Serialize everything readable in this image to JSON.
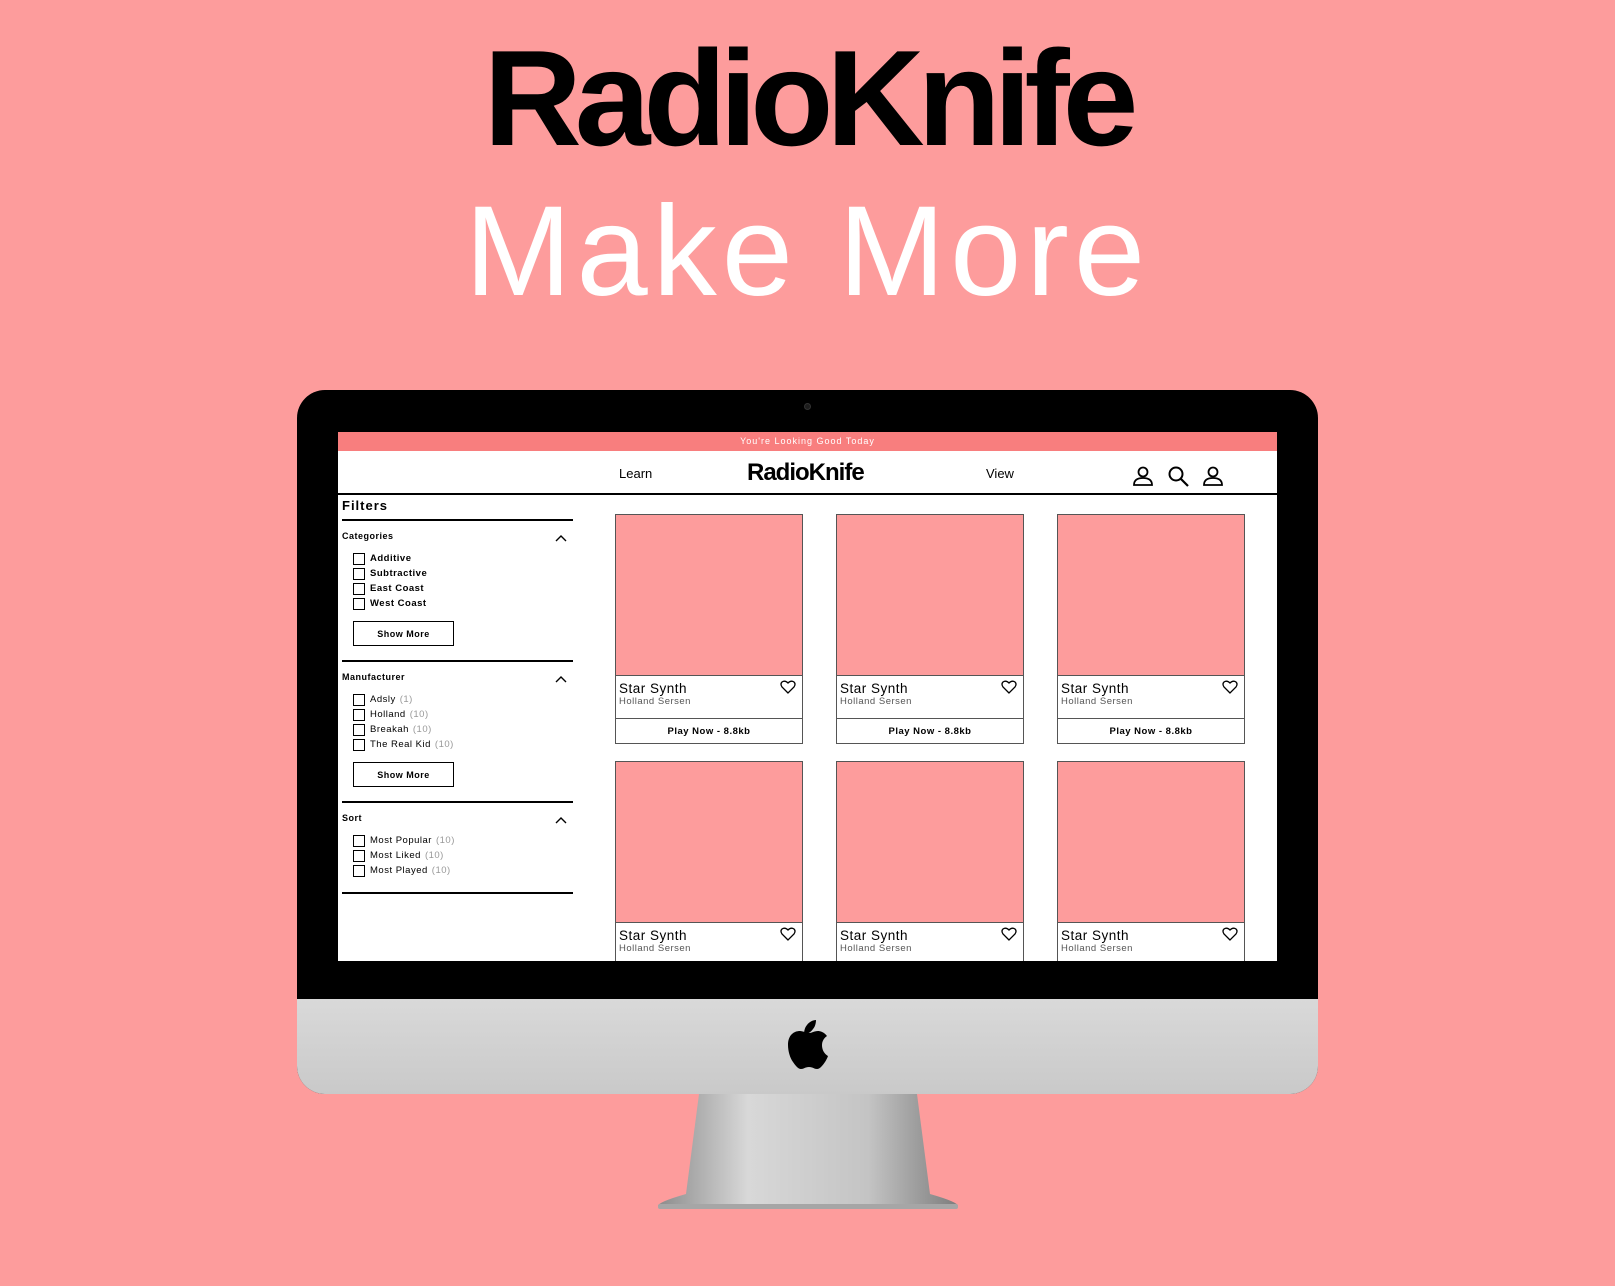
{
  "hero": {
    "title": "RadioKnife",
    "subtitle": "Make More"
  },
  "announcement": "You're Looking Good Today",
  "nav": {
    "links": [
      "Learn",
      "View"
    ],
    "logo": "RadioKnife",
    "icons": [
      "account-icon",
      "search-icon",
      "user-icon"
    ]
  },
  "sidebar": {
    "title": "Filters",
    "sections": [
      {
        "title": "Categories",
        "options": [
          {
            "label": "Additive",
            "count": ""
          },
          {
            "label": "Subtractive",
            "count": ""
          },
          {
            "label": "East Coast",
            "count": ""
          },
          {
            "label": "West Coast",
            "count": ""
          }
        ],
        "button": "Show More"
      },
      {
        "title": "Manufacturer",
        "options": [
          {
            "label": "Adsly",
            "count": "(1)"
          },
          {
            "label": "Holland",
            "count": "(10)"
          },
          {
            "label": "Breakah",
            "count": "(10)"
          },
          {
            "label": "The Real Kid",
            "count": "(10)"
          }
        ],
        "button": "Show More"
      },
      {
        "title": "Sort",
        "options": [
          {
            "label": "Most Popular",
            "count": "(10)"
          },
          {
            "label": "Most Liked",
            "count": "(10)"
          },
          {
            "label": "Most Played",
            "count": "(10)"
          }
        ],
        "button": ""
      }
    ]
  },
  "products": [
    {
      "name": "Star Synth",
      "maker": "Holland Sersen",
      "action": "Play Now - 8.8kb"
    },
    {
      "name": "Star Synth",
      "maker": "Holland Sersen",
      "action": "Play Now - 8.8kb"
    },
    {
      "name": "Star Synth",
      "maker": "Holland Sersen",
      "action": "Play Now - 8.8kb"
    },
    {
      "name": "Star Synth",
      "maker": "Holland Sersen",
      "action": ""
    },
    {
      "name": "Star Synth",
      "maker": "Holland Sersen",
      "action": ""
    },
    {
      "name": "Star Synth",
      "maker": "Holland Sersen",
      "action": ""
    }
  ],
  "colors": {
    "background": "#fd9c9c",
    "announcement_bar": "#f87e7e",
    "card_image": "#fd9c9c"
  }
}
